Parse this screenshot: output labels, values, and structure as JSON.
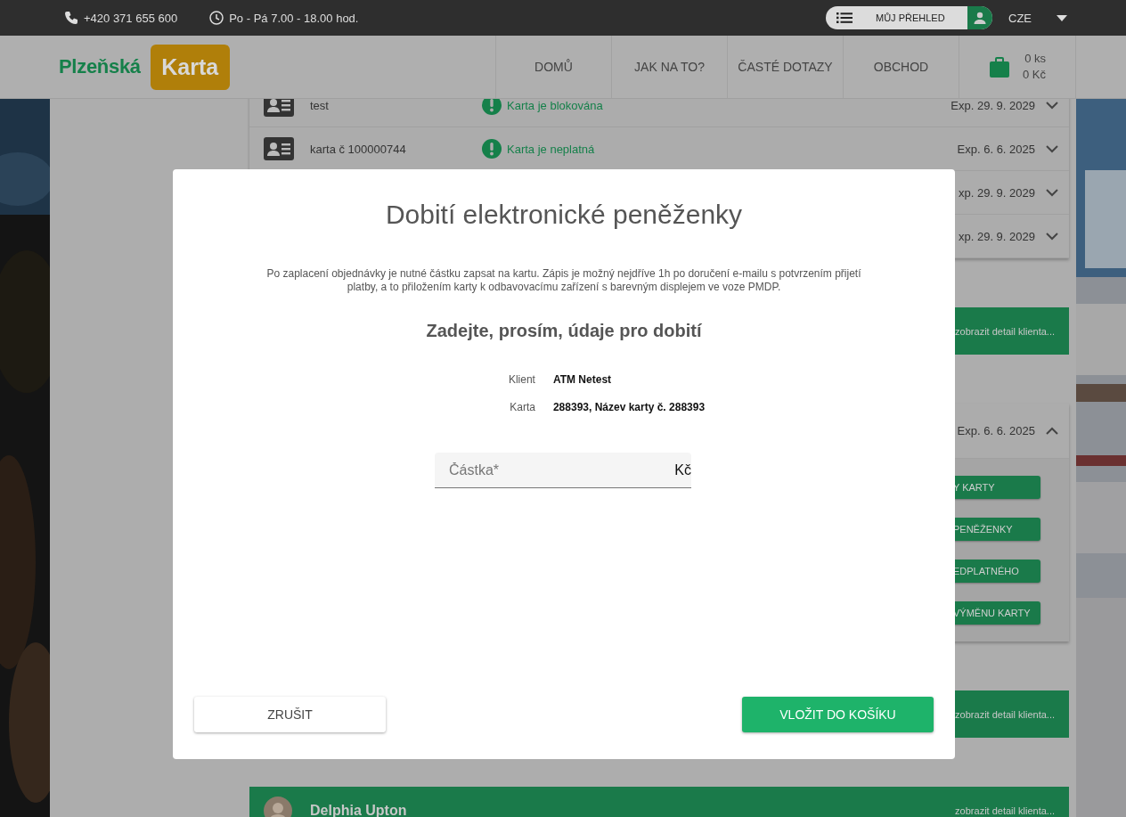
{
  "topbar": {
    "phone": "+420 371 655 600",
    "hours": "Po - Pá 7.00 - 18.00 hod.",
    "account_button": "MŮJ PŘEHLED",
    "language": "CZE"
  },
  "header": {
    "logo": {
      "text": "Plzeňská",
      "badge": "Karta"
    },
    "nav": [
      {
        "label": "DOMŮ"
      },
      {
        "label": "JAK NA TO?"
      },
      {
        "label": "ČASTÉ DOTAZY"
      },
      {
        "label": "OBCHOD"
      }
    ],
    "cart": {
      "count": "0 ks",
      "total": "0 Kč"
    }
  },
  "content": [
    {
      "kind": "card_list",
      "cards": [
        {
          "name": "test",
          "status": "Karta je blokována",
          "expiry": "Exp. 29. 9. 2029",
          "expanded": false
        },
        {
          "name": "karta č 100000744",
          "status": "Karta je neplatná",
          "expiry": "Exp. 6. 6. 2025",
          "expanded": false
        },
        {
          "expiry": "xp. 29. 9. 2029",
          "expanded": false
        },
        {
          "expiry": "xp. 29. 9. 2029",
          "expanded": false
        }
      ]
    },
    {
      "kind": "client_header",
      "link": "zobrazit detail klienta..."
    },
    {
      "kind": "card_list",
      "cards": [
        {
          "expiry": "Exp. 6. 6. 2025",
          "expanded": true,
          "actions": [
            "Y KARTY",
            "PENĚŽENKY",
            "EDPLATNÉHO",
            "VÝMĚNU KARTY"
          ]
        }
      ]
    },
    {
      "kind": "client_header",
      "link": "zobrazit detail klienta..."
    },
    {
      "kind": "client_header",
      "name": "Delphia Upton",
      "link": "zobrazit detail klienta..."
    }
  ],
  "modal": {
    "title": "Dobití elektronické peněženky",
    "note": "Po zaplacení objednávky je nutné částku zapsat na kartu. Zápis je možný nejdříve 1h po doručení e-mailu s potvrzením přijetí platby, a to přiložením karty k odbavovacímu zařízení s barevným displejem ve voze PMDP.",
    "heading": "Zadejte, prosím, údaje pro dobití",
    "details": [
      {
        "label": "Klient",
        "value": "ATM Netest"
      },
      {
        "label": "Karta",
        "value": "288393, Název karty č. 288393"
      }
    ],
    "amount_field": {
      "placeholder": "Částka*",
      "suffix": "Kč"
    },
    "buttons": [
      {
        "label": "ZRUŠIT",
        "kind": "secondary"
      },
      {
        "label": "VLOŽIT DO KOŠÍKU",
        "kind": "primary"
      }
    ]
  }
}
